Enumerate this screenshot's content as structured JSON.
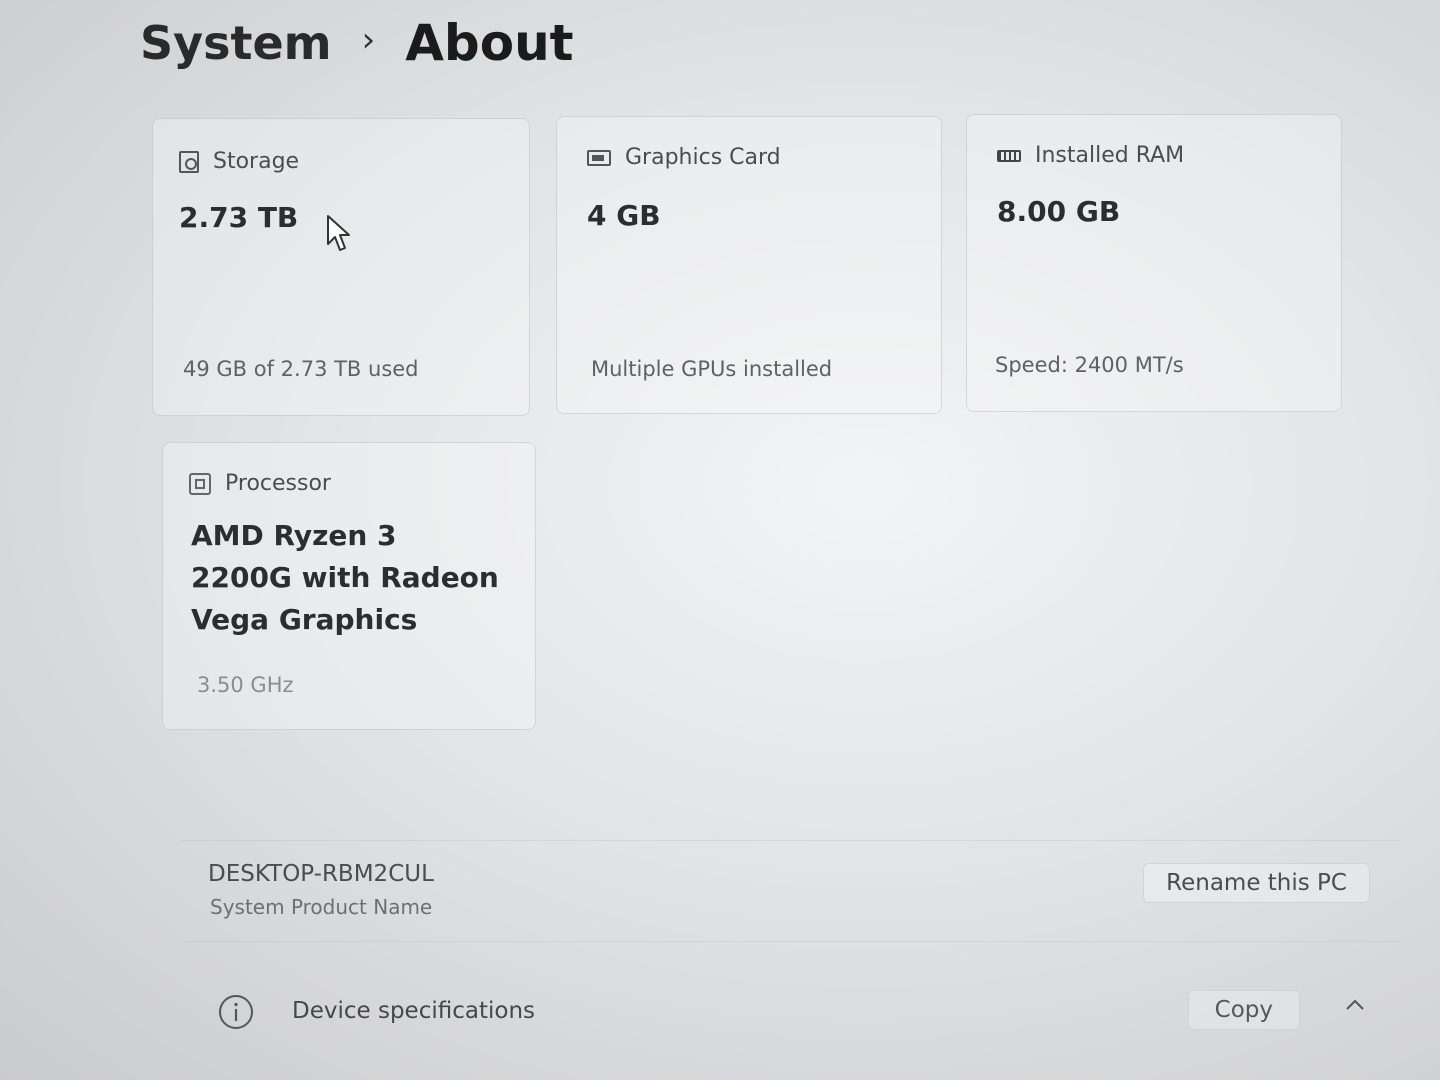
{
  "breadcrumb": {
    "parent": "System",
    "separator": "›",
    "current": "About"
  },
  "cards": {
    "storage": {
      "icon": "storage-icon",
      "label": "Storage",
      "value": "2.73 TB",
      "detail": "49 GB of 2.73 TB used"
    },
    "graphics": {
      "icon": "gpu-icon",
      "label": "Graphics Card",
      "value": "4 GB",
      "detail": "Multiple GPUs installed"
    },
    "ram": {
      "icon": "ram-icon",
      "label": "Installed RAM",
      "value": "8.00 GB",
      "detail": "Speed: 2400 MT/s"
    },
    "processor": {
      "icon": "cpu-icon",
      "label": "Processor",
      "value": "AMD Ryzen 3 2200G with Radeon Vega Graphics",
      "detail": "3.50 GHz"
    }
  },
  "pc": {
    "name": "DESKTOP-RBM2CUL",
    "subtitle": "System Product Name",
    "rename_label": "Rename this PC"
  },
  "device_specs": {
    "icon": "info-icon",
    "label": "Device specifications",
    "copy_label": "Copy",
    "expand_icon": "chevron-up-icon"
  }
}
